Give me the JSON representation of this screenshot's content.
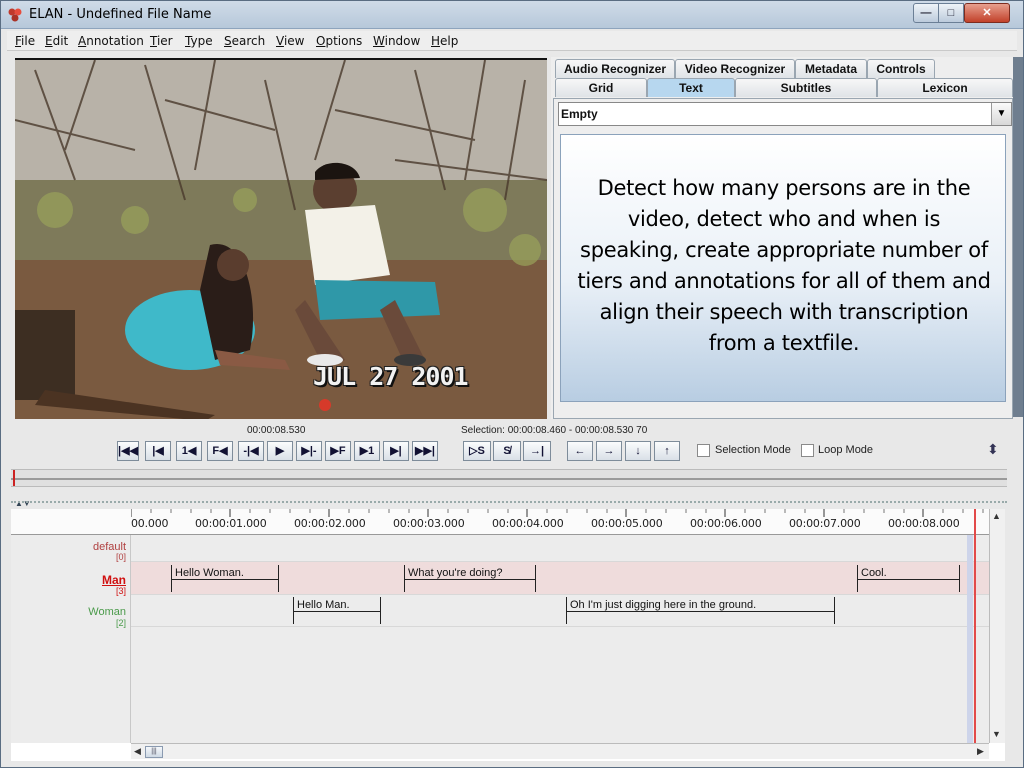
{
  "window": {
    "title": "ELAN - Undefined File Name",
    "minimize": "—",
    "maximize": "□",
    "close": "✕"
  },
  "menu": [
    {
      "label": "File",
      "u": "F",
      "rest": "ile"
    },
    {
      "label": "Edit",
      "u": "E",
      "rest": "dit"
    },
    {
      "label": "Annotation",
      "u": "A",
      "rest": "nnotation"
    },
    {
      "label": "Tier",
      "u": "T",
      "rest": "ier"
    },
    {
      "label": "Type",
      "u": "T",
      "rest": "ype"
    },
    {
      "label": "Search",
      "u": "S",
      "rest": "earch"
    },
    {
      "label": "View",
      "u": "V",
      "rest": "iew"
    },
    {
      "label": "Options",
      "u": "O",
      "rest": "ptions"
    },
    {
      "label": "Window",
      "u": "W",
      "rest": "indow"
    },
    {
      "label": "Help",
      "u": "H",
      "rest": "elp"
    }
  ],
  "video": {
    "date_overlay": "JUL 27 2001"
  },
  "tabs": {
    "row1": [
      "Audio Recognizer",
      "Video Recognizer",
      "Metadata",
      "Controls"
    ],
    "row2": [
      "Grid",
      "Text",
      "Subtitles",
      "Lexicon"
    ],
    "selected": "Text",
    "combo_value": "Empty",
    "instruction": "Detect how many persons are in the video, detect who and when is speaking, create appropriate number of tiers and annotations for all of them and align their speech with transcription from a textfile."
  },
  "controls": {
    "current_time": "00:00:08.530",
    "selection": "Selection: 00:00:08.460 - 00:00:08.530  70",
    "buttons": [
      "|◀◀",
      "|◀",
      "1◀",
      "F◀",
      "-|◀",
      "▶",
      "▶|-",
      "▶F",
      "▶1",
      "▶|",
      "▶▶|"
    ],
    "buttons2": [
      "▷S",
      "S̸",
      "→|"
    ],
    "buttons3": [
      "←",
      "→",
      "↓",
      "↑"
    ],
    "selection_mode": "Selection Mode",
    "loop_mode": "Loop Mode"
  },
  "timeline": {
    "ticks": [
      "00.000",
      "00:00:01.000",
      "00:00:02.000",
      "00:00:03.000",
      "00:00:04.000",
      "00:00:05.000",
      "00:00:06.000",
      "00:00:07.000",
      "00:00:08.000"
    ],
    "tiers": [
      {
        "name": "default",
        "count": "[0]",
        "color": "#b04040",
        "underline": false
      },
      {
        "name": "Man",
        "count": "[3]",
        "color": "#d01010",
        "underline": true
      },
      {
        "name": "Woman",
        "count": "[2]",
        "color": "#4a9a4a",
        "underline": false
      }
    ],
    "man_annotations": [
      "Hello Woman.",
      "What you're doing?",
      "Cool."
    ],
    "woman_annotations": [
      "Hello Man.",
      "Oh I'm just digging here in the ground."
    ],
    "scroll_thumb": "|||"
  },
  "colors": {
    "selected_tier_row": "#efdcdc",
    "crosshair": "#e24a4a",
    "selected_tab": "#b7d7ef"
  }
}
